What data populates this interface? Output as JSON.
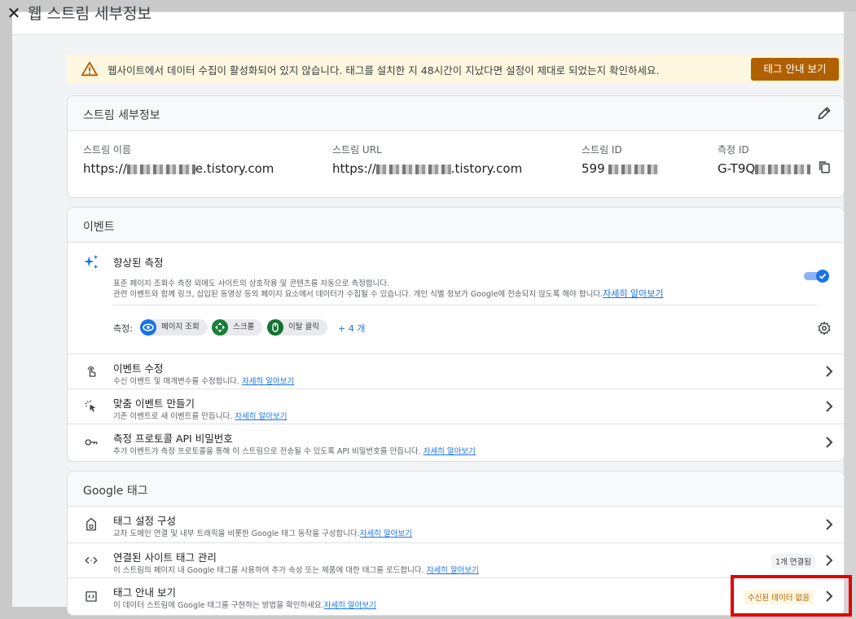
{
  "dialog": {
    "title": "웹 스트림 세부정보",
    "close_icon": "close-icon"
  },
  "banner": {
    "icon": "warning-icon",
    "text": "웹사이트에서 데이터 수집이 활성화되어 있지 않습니다. 태그를 설치한 지 48시간이 지났다면 설정이 제대로 되었는지 확인하세요.",
    "button_label": "태그 안내 보기",
    "button_color": "#b06000"
  },
  "stream_details": {
    "header": "스트림 세부정보",
    "fields": [
      {
        "label": "스트림 이름",
        "value_prefix": "https://",
        "value_suffix": "e.tistory.com"
      },
      {
        "label": "스트림 URL",
        "value_prefix": "https://",
        "value_suffix": ".tistory.com"
      },
      {
        "label": "스트림 ID",
        "value_prefix": "599",
        "value_suffix": ""
      },
      {
        "label": "측정 ID",
        "value_prefix": "G-T9Q",
        "value_suffix": ""
      }
    ]
  },
  "events": {
    "header": "이벤트",
    "enhanced": {
      "title": "향상된 측정",
      "desc1": "표준 페이지 조회수 측정 외에도 사이트의 상호작용 및 콘텐츠를 자동으로 측정합니다.",
      "desc2": "관련 이벤트와 함께 링크, 삽입된 동영상 등의 페이지 요소에서 데이터가 수집될 수 있습니다. 개인 식별 정보가 Google에 전송되지 않도록 해야 합니다.",
      "learn_more": "자세히 알아보기",
      "toggle_on": true,
      "measure_label": "측정:",
      "chips": [
        "페이지 조회",
        "스크롤",
        "이탈 클릭"
      ],
      "more": "+ 4 개"
    },
    "rows": [
      {
        "title": "이벤트 수정",
        "desc": "수신 이벤트 및 매개변수를 수정합니다. ",
        "link": "자세히 알아보기"
      },
      {
        "title": "맞춤 이벤트 만들기",
        "desc": "기존 이벤트로 새 이벤트를 만듭니다. ",
        "link": "자세히 알아보기"
      },
      {
        "title": "측정 프로토콜 API 비밀번호",
        "desc": "추가 이벤트가 측정 프로토콜을 통해 이 스트림으로 전송될 수 있도록 API 비밀번호를 만듭니다. ",
        "link": "자세히 알아보기"
      }
    ]
  },
  "google_tag": {
    "header": "Google 태그",
    "rows": [
      {
        "title": "태그 설정 구성",
        "desc": "교차 도메인 연결 및 내부 트래픽을 비롯한 Google 태그 동작을 구성합니다.",
        "link": "자세히 알아보기",
        "badge": ""
      },
      {
        "title": "연결된 사이트 태그 관리",
        "desc": "이 스트림의 페이지 내 Google 태그를 사용하여 추가 속성 또는 제품에 대한 태그를 로드합니다. ",
        "link": "자세히 알아보기",
        "badge": "1개 연결됨"
      },
      {
        "title": "태그 안내 보기",
        "desc": "이 데이터 스트림에 Google 태그를 구현하는 방법을 확인하세요.",
        "link": "자세히 알아보기",
        "badge": "수신된 데이터 없음"
      }
    ]
  },
  "colors": {
    "accent": "#1a73e8",
    "highlight_box": "#e50000",
    "warn_bg": "#fef7e0"
  }
}
